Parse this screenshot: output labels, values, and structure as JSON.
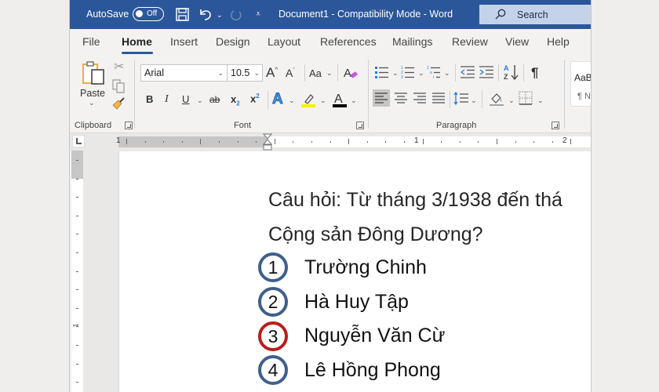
{
  "titlebar": {
    "autosave_label": "AutoSave",
    "autosave_state": "Off",
    "document_title": "Document1  -  Compatibility Mode  -  Word",
    "search_placeholder": "Search"
  },
  "tabs": [
    {
      "label": "File"
    },
    {
      "label": "Home",
      "active": true
    },
    {
      "label": "Insert"
    },
    {
      "label": "Design"
    },
    {
      "label": "Layout"
    },
    {
      "label": "References"
    },
    {
      "label": "Mailings"
    },
    {
      "label": "Review"
    },
    {
      "label": "View"
    },
    {
      "label": "Help"
    }
  ],
  "ribbon": {
    "clipboard": {
      "label": "Clipboard",
      "paste_label": "Paste"
    },
    "font": {
      "label": "Font",
      "font_name": "Arial",
      "font_size": "10.5",
      "change_case": "Aa",
      "highlight_color": "#f7f300",
      "font_color": "#000000"
    },
    "paragraph": {
      "label": "Paragraph"
    },
    "styles": {
      "preview_text": "AaB",
      "preview_sub": "¶ N"
    }
  },
  "ruler": {
    "numbers": [
      "1",
      "1",
      "2"
    ],
    "vertical_number": "1"
  },
  "document": {
    "question_line1": "Câu hỏi: Từ tháng 3/1938 đến thá",
    "question_line2": "Cộng sản Đông Dương?",
    "options": [
      {
        "number": "1",
        "text": "Trường Chinh",
        "correct": false
      },
      {
        "number": "2",
        "text": "Hà Huy Tập",
        "correct": false
      },
      {
        "number": "3",
        "text": "Nguyễn Văn Cừ",
        "correct": true
      },
      {
        "number": "4",
        "text": "Lê Hồng Phong",
        "correct": false
      }
    ],
    "colors": {
      "option_ring": "#3f5f8c",
      "correct_ring": "#b81d1d"
    }
  },
  "colors": {
    "brand": "#2b579a"
  }
}
